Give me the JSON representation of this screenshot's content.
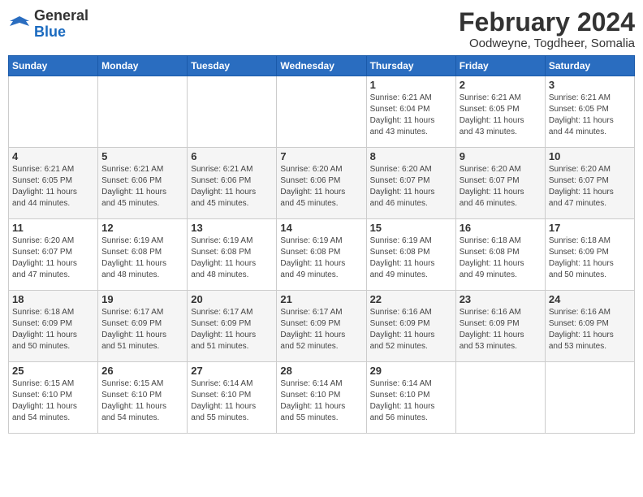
{
  "header": {
    "logo": {
      "general": "General",
      "blue": "Blue"
    },
    "title": "February 2024",
    "location": "Oodweyne, Togdheer, Somalia"
  },
  "weekdays": [
    "Sunday",
    "Monday",
    "Tuesday",
    "Wednesday",
    "Thursday",
    "Friday",
    "Saturday"
  ],
  "weeks": [
    [
      {
        "day": "",
        "info": ""
      },
      {
        "day": "",
        "info": ""
      },
      {
        "day": "",
        "info": ""
      },
      {
        "day": "",
        "info": ""
      },
      {
        "day": "1",
        "info": "Sunrise: 6:21 AM\nSunset: 6:04 PM\nDaylight: 11 hours\nand 43 minutes."
      },
      {
        "day": "2",
        "info": "Sunrise: 6:21 AM\nSunset: 6:05 PM\nDaylight: 11 hours\nand 43 minutes."
      },
      {
        "day": "3",
        "info": "Sunrise: 6:21 AM\nSunset: 6:05 PM\nDaylight: 11 hours\nand 44 minutes."
      }
    ],
    [
      {
        "day": "4",
        "info": "Sunrise: 6:21 AM\nSunset: 6:05 PM\nDaylight: 11 hours\nand 44 minutes."
      },
      {
        "day": "5",
        "info": "Sunrise: 6:21 AM\nSunset: 6:06 PM\nDaylight: 11 hours\nand 45 minutes."
      },
      {
        "day": "6",
        "info": "Sunrise: 6:21 AM\nSunset: 6:06 PM\nDaylight: 11 hours\nand 45 minutes."
      },
      {
        "day": "7",
        "info": "Sunrise: 6:20 AM\nSunset: 6:06 PM\nDaylight: 11 hours\nand 45 minutes."
      },
      {
        "day": "8",
        "info": "Sunrise: 6:20 AM\nSunset: 6:07 PM\nDaylight: 11 hours\nand 46 minutes."
      },
      {
        "day": "9",
        "info": "Sunrise: 6:20 AM\nSunset: 6:07 PM\nDaylight: 11 hours\nand 46 minutes."
      },
      {
        "day": "10",
        "info": "Sunrise: 6:20 AM\nSunset: 6:07 PM\nDaylight: 11 hours\nand 47 minutes."
      }
    ],
    [
      {
        "day": "11",
        "info": "Sunrise: 6:20 AM\nSunset: 6:07 PM\nDaylight: 11 hours\nand 47 minutes."
      },
      {
        "day": "12",
        "info": "Sunrise: 6:19 AM\nSunset: 6:08 PM\nDaylight: 11 hours\nand 48 minutes."
      },
      {
        "day": "13",
        "info": "Sunrise: 6:19 AM\nSunset: 6:08 PM\nDaylight: 11 hours\nand 48 minutes."
      },
      {
        "day": "14",
        "info": "Sunrise: 6:19 AM\nSunset: 6:08 PM\nDaylight: 11 hours\nand 49 minutes."
      },
      {
        "day": "15",
        "info": "Sunrise: 6:19 AM\nSunset: 6:08 PM\nDaylight: 11 hours\nand 49 minutes."
      },
      {
        "day": "16",
        "info": "Sunrise: 6:18 AM\nSunset: 6:08 PM\nDaylight: 11 hours\nand 49 minutes."
      },
      {
        "day": "17",
        "info": "Sunrise: 6:18 AM\nSunset: 6:09 PM\nDaylight: 11 hours\nand 50 minutes."
      }
    ],
    [
      {
        "day": "18",
        "info": "Sunrise: 6:18 AM\nSunset: 6:09 PM\nDaylight: 11 hours\nand 50 minutes."
      },
      {
        "day": "19",
        "info": "Sunrise: 6:17 AM\nSunset: 6:09 PM\nDaylight: 11 hours\nand 51 minutes."
      },
      {
        "day": "20",
        "info": "Sunrise: 6:17 AM\nSunset: 6:09 PM\nDaylight: 11 hours\nand 51 minutes."
      },
      {
        "day": "21",
        "info": "Sunrise: 6:17 AM\nSunset: 6:09 PM\nDaylight: 11 hours\nand 52 minutes."
      },
      {
        "day": "22",
        "info": "Sunrise: 6:16 AM\nSunset: 6:09 PM\nDaylight: 11 hours\nand 52 minutes."
      },
      {
        "day": "23",
        "info": "Sunrise: 6:16 AM\nSunset: 6:09 PM\nDaylight: 11 hours\nand 53 minutes."
      },
      {
        "day": "24",
        "info": "Sunrise: 6:16 AM\nSunset: 6:09 PM\nDaylight: 11 hours\nand 53 minutes."
      }
    ],
    [
      {
        "day": "25",
        "info": "Sunrise: 6:15 AM\nSunset: 6:10 PM\nDaylight: 11 hours\nand 54 minutes."
      },
      {
        "day": "26",
        "info": "Sunrise: 6:15 AM\nSunset: 6:10 PM\nDaylight: 11 hours\nand 54 minutes."
      },
      {
        "day": "27",
        "info": "Sunrise: 6:14 AM\nSunset: 6:10 PM\nDaylight: 11 hours\nand 55 minutes."
      },
      {
        "day": "28",
        "info": "Sunrise: 6:14 AM\nSunset: 6:10 PM\nDaylight: 11 hours\nand 55 minutes."
      },
      {
        "day": "29",
        "info": "Sunrise: 6:14 AM\nSunset: 6:10 PM\nDaylight: 11 hours\nand 56 minutes."
      },
      {
        "day": "",
        "info": ""
      },
      {
        "day": "",
        "info": ""
      }
    ]
  ]
}
